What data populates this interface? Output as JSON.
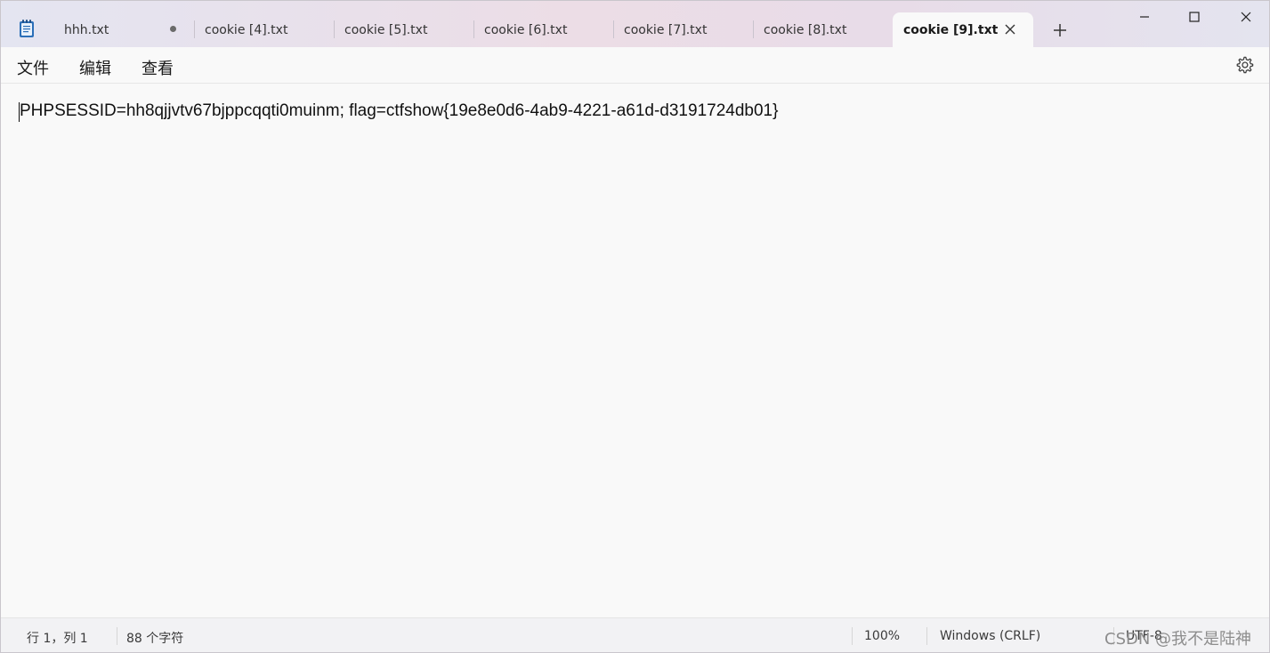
{
  "tabs": [
    {
      "label": "hhh.txt",
      "dirty": true
    },
    {
      "label": "cookie [4].txt"
    },
    {
      "label": "cookie [5].txt"
    },
    {
      "label": "cookie [6].txt"
    },
    {
      "label": "cookie [7].txt"
    },
    {
      "label": "cookie [8].txt"
    },
    {
      "label": "cookie [9].txt",
      "active": true
    }
  ],
  "menu": {
    "file": "文件",
    "edit": "编辑",
    "view": "查看"
  },
  "editor": {
    "content": "PHPSESSID=hh8qjjvtv67bjppcqqti0muinm; flag=ctfshow{19e8e0d6-4ab9-4221-a61d-d3191724db01}"
  },
  "status": {
    "position": "行 1，列 1",
    "char_count": "88 个字符",
    "zoom": "100%",
    "line_ending": "Windows (CRLF)",
    "encoding": "UTF-8"
  },
  "watermark": "CSDN @我不是陆神",
  "icons": {
    "app": "notepad-icon",
    "close": "close-icon",
    "add": "plus-icon",
    "settings": "gear-icon"
  },
  "colors": {
    "titlebar": "#e8e0ea",
    "editor_bg": "#f9f9f9",
    "statusbar": "#f2f2f4"
  }
}
